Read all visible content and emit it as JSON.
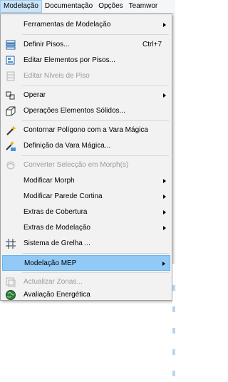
{
  "menubar": {
    "items": [
      "Modelação",
      "Documentação",
      "Opções",
      "Teamwor"
    ]
  },
  "menu": {
    "items": [
      {
        "label": "Ferramentas de Modelação",
        "icon": "",
        "submenu": true
      },
      {
        "label": "Definir Pisos...",
        "icon": "floor-stack-icon",
        "shortcut": "Ctrl+7"
      },
      {
        "label": "Editar Elementos por Pisos...",
        "icon": "edit-elements-icon"
      },
      {
        "label": "Editar Níveis de Piso",
        "icon": "floor-levels-icon",
        "disabled": true
      },
      {
        "label": "Operar",
        "icon": "operate-icon",
        "submenu": true
      },
      {
        "label": "Operações Elementos Sólidos...",
        "icon": "solid-operations-icon"
      },
      {
        "label": "Contornar Polígono com a Vara Mágica",
        "icon": "magic-wand-icon"
      },
      {
        "label": "Definição da Vara Mágica...",
        "icon": "magic-wand-settings-icon"
      },
      {
        "label": "Converter Selecção em Morph(s)",
        "icon": "morph-icon",
        "disabled": true
      },
      {
        "label": "Modificar Morph",
        "icon": "",
        "submenu": true
      },
      {
        "label": "Modificar Parede Cortina",
        "icon": "",
        "submenu": true
      },
      {
        "label": "Extras de Cobertura",
        "icon": "",
        "submenu": true
      },
      {
        "label": "Extras de Modelação",
        "icon": "",
        "submenu": true
      },
      {
        "label": "Sistema de Grelha ...",
        "icon": "grid-system-icon"
      },
      {
        "label": "Modelação MEP",
        "icon": "",
        "submenu": true,
        "highlighted": true
      },
      {
        "label": "Actualizar Zonas...",
        "icon": "zones-icon",
        "disabled": true
      },
      {
        "label": "Avaliação Energética",
        "icon": "energy-globe-icon"
      }
    ]
  }
}
